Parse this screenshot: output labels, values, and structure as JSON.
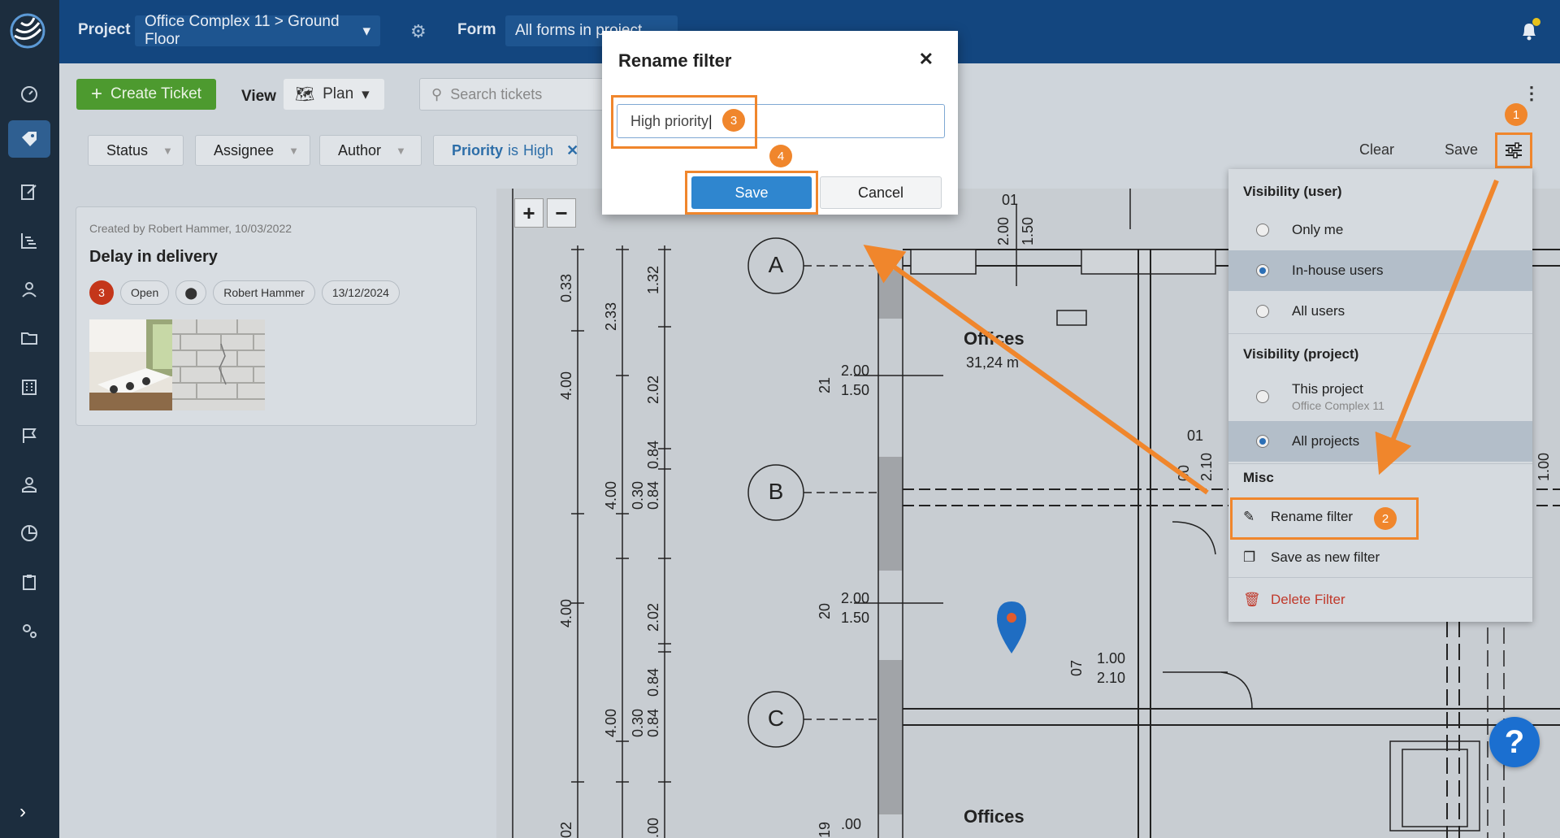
{
  "topbar": {
    "project_label": "Project",
    "project_value": "Office Complex 11 > Ground Floor",
    "form_label": "Form",
    "form_value": "All forms in project"
  },
  "toolbar": {
    "create_ticket": "Create Ticket",
    "view_label": "View",
    "view_value": "Plan",
    "search_placeholder": "Search tickets",
    "filters": {
      "status": "Status",
      "assignee": "Assignee",
      "author": "Author",
      "priority_prefix": "Priority",
      "priority_is": "is",
      "priority_value": "High"
    },
    "clear": "Clear",
    "save": "Save"
  },
  "ticket": {
    "meta": "Created by Robert Hammer, 10/03/2022",
    "title": "Delay in delivery",
    "number": "3",
    "status": "Open",
    "assignee": "Robert Hammer",
    "date": "13/12/2024"
  },
  "plan": {
    "rooms": [
      "Offices",
      "31,24 m",
      "Offices"
    ],
    "grid_labels": [
      "A",
      "B",
      "C"
    ],
    "dims": [
      "0.33",
      "2.33",
      "1.32",
      "4.00",
      "2.02",
      "4.00",
      "0.30",
      "0.84",
      "0.84",
      "4.00",
      "2.02",
      "4.00",
      "0.30",
      "0.84",
      "0.84",
      "2.00",
      "1.50",
      "2.00",
      "1.50",
      "1.00",
      "2.10",
      "01",
      "2.00",
      "1.50",
      "01",
      "00",
      "2.10",
      "21",
      "20",
      "07",
      "19",
      "2.00",
      ".00",
      "02",
      ".00",
      "1.00",
      "02"
    ]
  },
  "menu": {
    "visibility_user": "Visibility (user)",
    "only_me": "Only me",
    "in_house": "In-house users",
    "all_users": "All users",
    "visibility_project": "Visibility (project)",
    "this_project": "This project",
    "this_project_sub": "Office Complex 11",
    "all_projects": "All projects",
    "misc": "Misc",
    "rename": "Rename filter",
    "save_new": "Save as new filter",
    "delete": "Delete Filter"
  },
  "modal": {
    "title": "Rename filter",
    "input_value": "High priority",
    "save": "Save",
    "cancel": "Cancel"
  },
  "badges": [
    "1",
    "2",
    "3",
    "4"
  ],
  "help": "?",
  "colors": {
    "accent": "#f0862c",
    "topbar": "#13467f",
    "nav": "#1c2d3e",
    "primary": "#2f86cf",
    "danger": "#c0392b",
    "green": "#4d9a2f"
  }
}
